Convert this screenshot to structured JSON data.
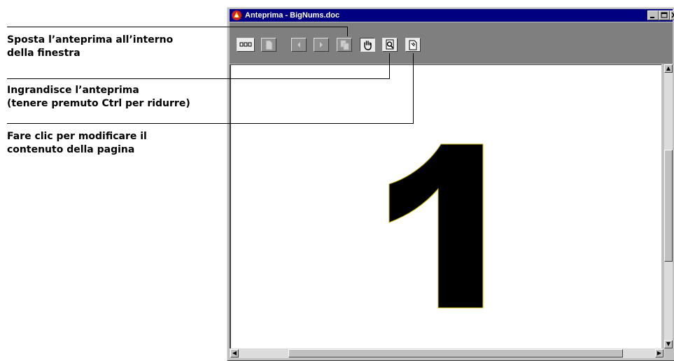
{
  "callouts": [
    {
      "text": "Sposta l’anteprima all’interno\ndella finestra"
    },
    {
      "text": "Ingrandisce l’anteprima\n(tenere premuto Ctrl per ridurre)"
    },
    {
      "text": "Fare clic per modificare il\ncontenuto della pagina"
    }
  ],
  "window": {
    "title": "Anteprima - BigNums.doc"
  },
  "toolbar": {
    "buttons": [
      {
        "name": "thumbnails-button",
        "icon": "thumbnails-icon"
      },
      {
        "name": "page-button",
        "icon": "page-icon"
      },
      {
        "name": "previous-page-button",
        "icon": "arrow-left-icon"
      },
      {
        "name": "next-page-button",
        "icon": "arrow-right-icon"
      },
      {
        "name": "copy-page-button",
        "icon": "copy-pages-icon"
      },
      {
        "name": "pan-tool-button",
        "icon": "hand-icon"
      },
      {
        "name": "zoom-tool-button",
        "icon": "magnifier-icon"
      },
      {
        "name": "edit-page-button",
        "icon": "edit-page-icon"
      }
    ]
  },
  "preview": {
    "page_content": "1"
  },
  "colors": {
    "titlebar": "#000080",
    "toolbar": "#7f7f7f",
    "glyph_outline": "#c8b400"
  }
}
